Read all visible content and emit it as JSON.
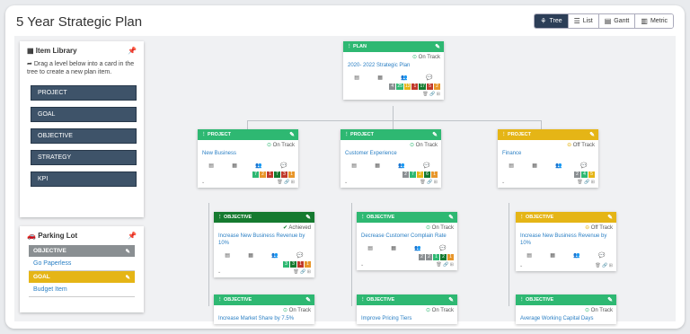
{
  "title": "5 Year Strategic Plan",
  "views": [
    {
      "label": "Tree",
      "icon": "tree-icon",
      "glyph": "⚘"
    },
    {
      "label": "List",
      "icon": "list-icon",
      "glyph": "☰"
    },
    {
      "label": "Gantt",
      "icon": "gantt-icon",
      "glyph": "▤"
    },
    {
      "label": "Metric",
      "icon": "metric-icon",
      "glyph": "▥"
    }
  ],
  "item_library": {
    "title": "Item Library",
    "note": "Drag a level below into a card in the tree to create a new plan item.",
    "items": [
      "PROJECT",
      "GOAL",
      "OBJECTIVE",
      "STRATEGY",
      "KPI"
    ]
  },
  "parking_lot": {
    "title": "Parking Lot",
    "items": [
      {
        "type": "OBJECTIVE",
        "name": "Go Paperless",
        "color": "#8a8f92"
      },
      {
        "type": "GOAL",
        "name": "Budget Item",
        "color": "#e5b516"
      }
    ]
  },
  "colors": {
    "green": "#2eb872",
    "dark_green": "#157a2f",
    "yellow": "#e5b516",
    "gray": "#8a8f92",
    "red": "#c0392b",
    "orange": "#e8962a",
    "navy": "#2c3e57"
  },
  "cards": {
    "plan": {
      "type": "PLAN",
      "status": "On Track",
      "name": "2020- 2022 Strategic Plan",
      "color": "#2eb872",
      "badges": [
        {
          "v": "4",
          "c": "#8a8f92"
        },
        {
          "v": "25",
          "c": "#2eb872"
        },
        {
          "v": "13",
          "c": "#e5b516"
        },
        {
          "v": "1",
          "c": "#c0392b"
        },
        {
          "v": "17",
          "c": "#157a2f"
        },
        {
          "v": "5",
          "c": "#c0392b"
        },
        {
          "v": "2",
          "c": "#e8962a"
        }
      ]
    },
    "p1": {
      "type": "PROJECT",
      "status": "On Track",
      "name": "New Business",
      "color": "#2eb872",
      "badges": [
        {
          "v": "7",
          "c": "#2eb872"
        },
        {
          "v": "2",
          "c": "#e8962a"
        },
        {
          "v": "1",
          "c": "#c0392b"
        },
        {
          "v": "7",
          "c": "#157a2f"
        },
        {
          "v": "3",
          "c": "#c0392b"
        },
        {
          "v": "1",
          "c": "#e8962a"
        }
      ]
    },
    "p2": {
      "type": "PROJECT",
      "status": "On Track",
      "name": "Customer Experience",
      "color": "#2eb872",
      "badges": [
        {
          "v": "2",
          "c": "#8a8f92"
        },
        {
          "v": "7",
          "c": "#2eb872"
        },
        {
          "v": "2",
          "c": "#e5b516"
        },
        {
          "v": "6",
          "c": "#157a2f"
        },
        {
          "v": "1",
          "c": "#e8962a"
        }
      ]
    },
    "p3": {
      "type": "PROJECT",
      "status": "Off Track",
      "name": "Finance",
      "color": "#e5b516",
      "badges": [
        {
          "v": "2",
          "c": "#8a8f92"
        },
        {
          "v": "4",
          "c": "#2eb872"
        },
        {
          "v": "5",
          "c": "#e5b516"
        }
      ]
    },
    "o1": {
      "type": "OBJECTIVE",
      "status": "Achieved",
      "name": "Increase New Business Revenue by 10%",
      "color": "#157a2f",
      "badges": [
        {
          "v": "3",
          "c": "#2eb872"
        },
        {
          "v": "3",
          "c": "#157a2f"
        },
        {
          "v": "1",
          "c": "#c0392b"
        },
        {
          "v": "1",
          "c": "#e8962a"
        }
      ]
    },
    "o2": {
      "type": "OBJECTIVE",
      "status": "On Track",
      "name": "Decrease Customer Complain Rate",
      "color": "#2eb872",
      "badges": [
        {
          "v": "2",
          "c": "#8a8f92"
        },
        {
          "v": "2",
          "c": "#8a8f92"
        },
        {
          "v": "1",
          "c": "#2eb872"
        },
        {
          "v": "2",
          "c": "#157a2f"
        },
        {
          "v": "1",
          "c": "#e8962a"
        }
      ]
    },
    "o3": {
      "type": "OBJECTIVE",
      "status": "Off Track",
      "name": "Increase New Business Revenue by 10%",
      "color": "#e5b516",
      "badges": []
    },
    "o4": {
      "type": "OBJECTIVE",
      "status": "On Track",
      "name": "Increase Market Share by 7.5%",
      "color": "#2eb872",
      "badges": []
    },
    "o5": {
      "type": "OBJECTIVE",
      "status": "On Track",
      "name": "Improve Pricing Tiers",
      "color": "#2eb872",
      "badges": []
    },
    "o6": {
      "type": "OBJECTIVE",
      "status": "On Track",
      "name": "Average Working Capital Days",
      "color": "#2eb872",
      "badges": []
    }
  }
}
